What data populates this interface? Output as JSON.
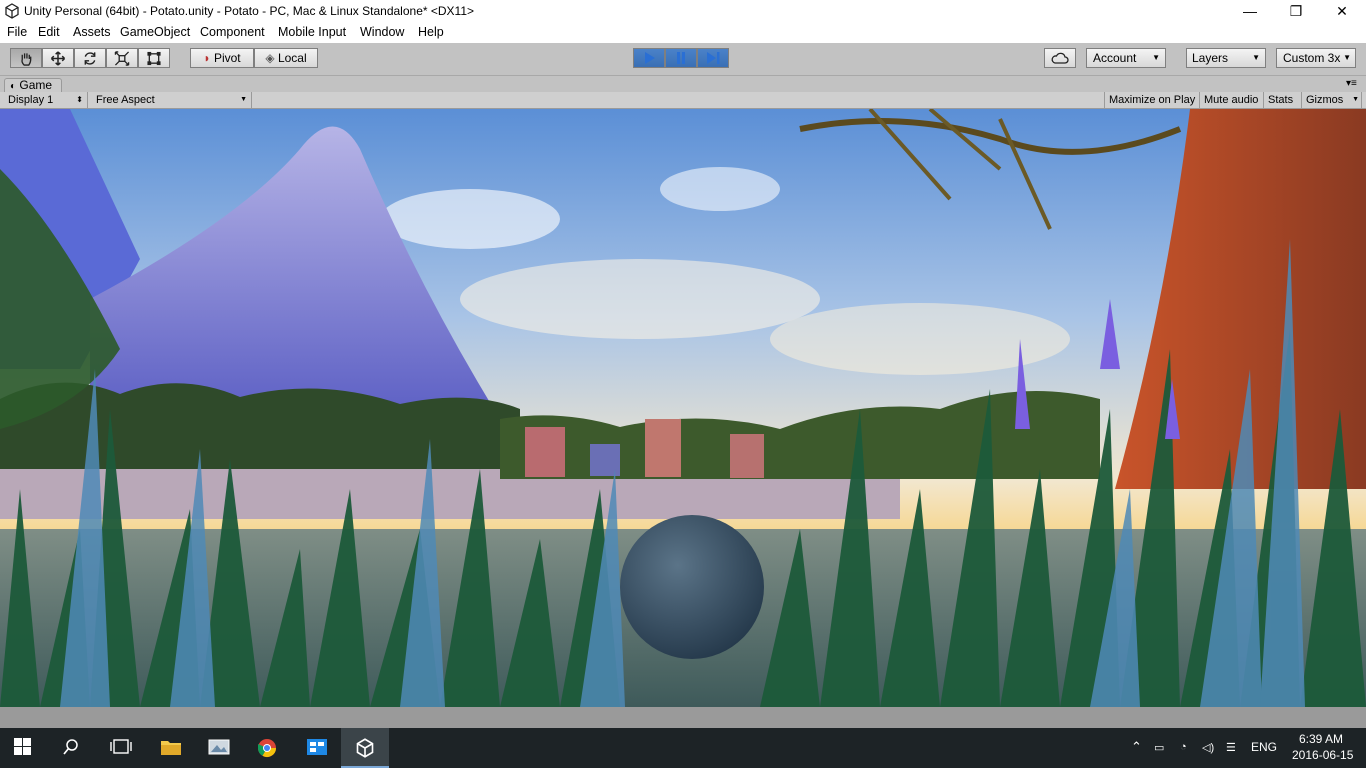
{
  "window": {
    "title": "Unity Personal (64bit) - Potato.unity - Potato - PC, Mac & Linux Standalone* <DX11>",
    "controls": {
      "minimize": "—",
      "maximize": "❐",
      "close": "✕"
    }
  },
  "menu": [
    "File",
    "Edit",
    "Assets",
    "GameObject",
    "Component",
    "Mobile Input",
    "Window",
    "Help"
  ],
  "toolbar": {
    "tools": [
      "hand-tool",
      "move-tool",
      "rotate-tool",
      "scale-tool",
      "rect-tool"
    ],
    "pivot_label": "Pivot",
    "local_label": "Local",
    "playback": [
      "play",
      "pause",
      "step"
    ],
    "account_label": "Account",
    "layers_label": "Layers",
    "layout_label": "Custom 3x"
  },
  "game_panel": {
    "tab_label": "Game",
    "display_label": "Display 1",
    "aspect_label": "Free Aspect",
    "maximize_label": "Maximize on Play",
    "mute_label": "Mute audio",
    "stats_label": "Stats",
    "gizmos_label": "Gizmos"
  },
  "taskbar": {
    "apps": [
      "start",
      "search",
      "task-view",
      "file-explorer",
      "photos",
      "chrome",
      "store",
      "unity"
    ],
    "language": "ENG",
    "time": "6:39 AM",
    "date": "2016-06-15"
  },
  "colors": {
    "accent": "#3a6fb4",
    "panel": "#c2c2c2",
    "taskbar": "#1d2326"
  }
}
